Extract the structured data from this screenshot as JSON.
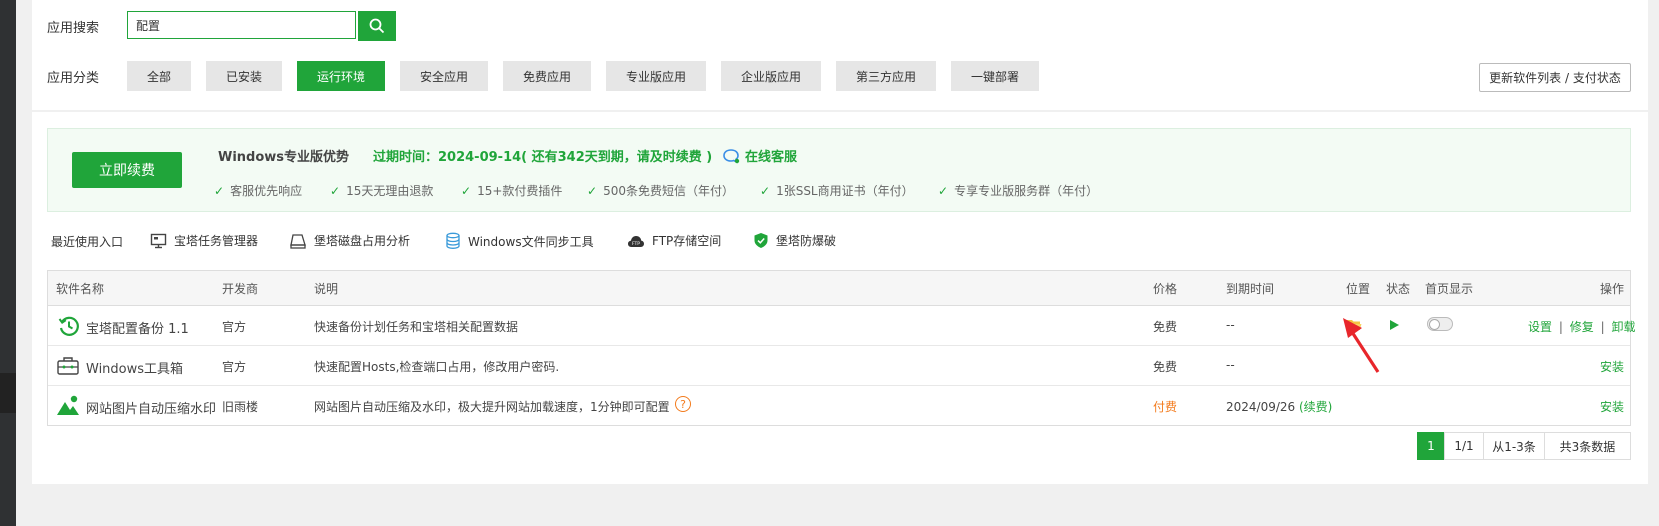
{
  "search": {
    "label": "应用搜索",
    "value": "配置"
  },
  "category": {
    "label": "应用分类",
    "items": [
      "全部",
      "已安装",
      "运行环境",
      "安全应用",
      "免费应用",
      "专业版应用",
      "企业版应用",
      "第三方应用",
      "一键部署"
    ],
    "active": "运行环境"
  },
  "update_button": "更新软件列表 / 支付状态",
  "promo": {
    "renew_button": "立即续费",
    "title": "Windows专业版优势",
    "expire": "过期时间：2024-09-14( 还有342天到期，请及时续费 )",
    "service": "在线客服",
    "features": [
      "客服优先响应",
      "15天无理由退款",
      "15+款付费插件",
      "500条免费短信（年付）",
      "1张SSL商用证书（年付）",
      "专享专业版服务群（年付）"
    ]
  },
  "recent": {
    "label": "最近使用入口",
    "items": [
      "宝塔任务管理器",
      "堡塔磁盘占用分析",
      "Windows文件同步工具",
      "FTP存储空间",
      "堡塔防爆破"
    ]
  },
  "table": {
    "headers": [
      "软件名称",
      "开发商",
      "说明",
      "价格",
      "到期时间",
      "位置",
      "状态",
      "首页显示",
      "操作"
    ],
    "rows": [
      {
        "name": "宝塔配置备份 1.1",
        "vendor": "官方",
        "desc": "快速备份计划任务和宝塔相关配置数据",
        "price": "免费",
        "expire": "--",
        "ops": [
          "设置",
          "修复",
          "卸载"
        ],
        "sep": "|"
      },
      {
        "name": "Windows工具箱",
        "vendor": "官方",
        "desc": "快速配置Hosts,检查端口占用，修改用户密码.",
        "price": "免费",
        "expire": "--",
        "ops": [
          "安装"
        ]
      },
      {
        "name": "网站图片自动压缩水印",
        "vendor": "旧雨楼",
        "desc": "网站图片自动压缩及水印，极大提升网站加载速度，1分钟即可配置",
        "help": "?",
        "price": "付费",
        "expire": "2024/09/26",
        "expire_link": "(续费)",
        "ops": [
          "安装"
        ]
      }
    ]
  },
  "pagination": {
    "current": "1",
    "pages": "1/1",
    "range": "从1-3条",
    "total": "共3条数据"
  },
  "colors": {
    "accent": "#20a53a",
    "paid": "#f37b1d",
    "arrow": "#e8262b"
  }
}
